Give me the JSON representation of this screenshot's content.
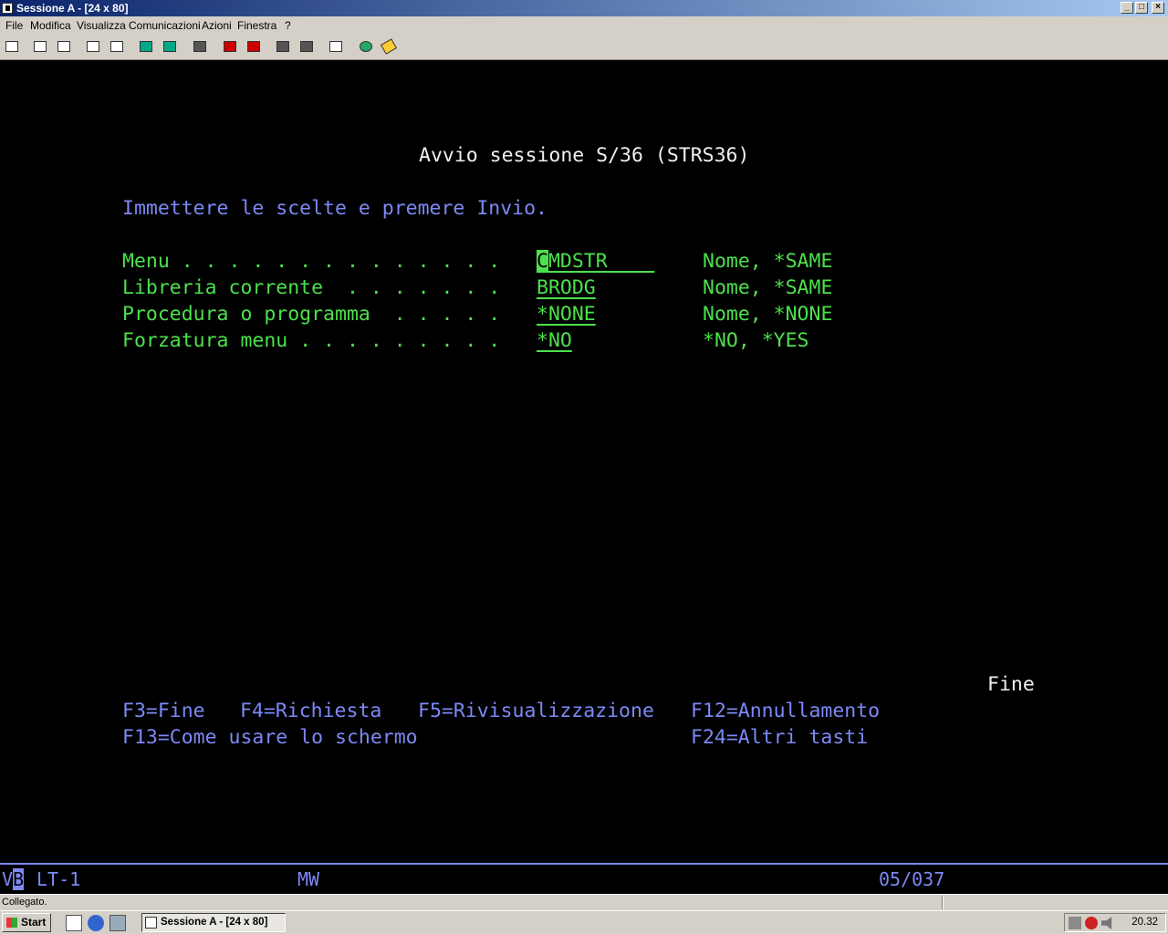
{
  "window": {
    "title": "Sessione A - [24 x 80]"
  },
  "menu": [
    "File",
    "Modifica",
    "Visualizza",
    "Comunicazioni",
    "Azioni",
    "Finestra",
    "?"
  ],
  "toolbar_icons": [
    "print-screen-icon",
    "copy-icon",
    "paste-icon",
    "send-icon",
    "receive-icon",
    "display-icon",
    "keypad-icon",
    "macro-icon",
    "record-icon",
    "stop-icon",
    "play-icon",
    "edit-macro-icon",
    "clipboard-icon",
    "globe-icon",
    "tag-icon"
  ],
  "terminal": {
    "title": "Avvio sessione S/36 (STRS36)",
    "instruction": "Immettere le scelte e premere Invio.",
    "fields": [
      {
        "label": "Menu . . . . . . . . . . . . . .",
        "value": "CMDSTR",
        "hint": "Nome, *SAME"
      },
      {
        "label": "Libreria corrente  . . . . . . .",
        "value": "BRODG",
        "hint": "Nome, *SAME"
      },
      {
        "label": "Procedura o programma  . . . . .",
        "value": "*NONE",
        "hint": "Nome, *NONE"
      },
      {
        "label": "Forzatura menu . . . . . . . . .",
        "value": "*NO",
        "hint": "*NO, *YES"
      }
    ],
    "more_indicator": "Fine",
    "fkeys": {
      "f3": "F3=Fine",
      "f4": "F4=Richiesta",
      "f5": "F5=Rivisualizzazione",
      "f12": "F12=Annullamento",
      "f13": "F13=Come usare lo schermo",
      "f24": "F24=Altri tasti"
    }
  },
  "oia": {
    "left_a": "V",
    "left_b": "B",
    "left_c": "LT-1",
    "middle": "MW",
    "cursor_pos": "05/037"
  },
  "status": {
    "text": "Collegato."
  },
  "taskbar": {
    "start": "Start",
    "task": "Sessione A - [24 x 80]",
    "clock": "20.32"
  }
}
